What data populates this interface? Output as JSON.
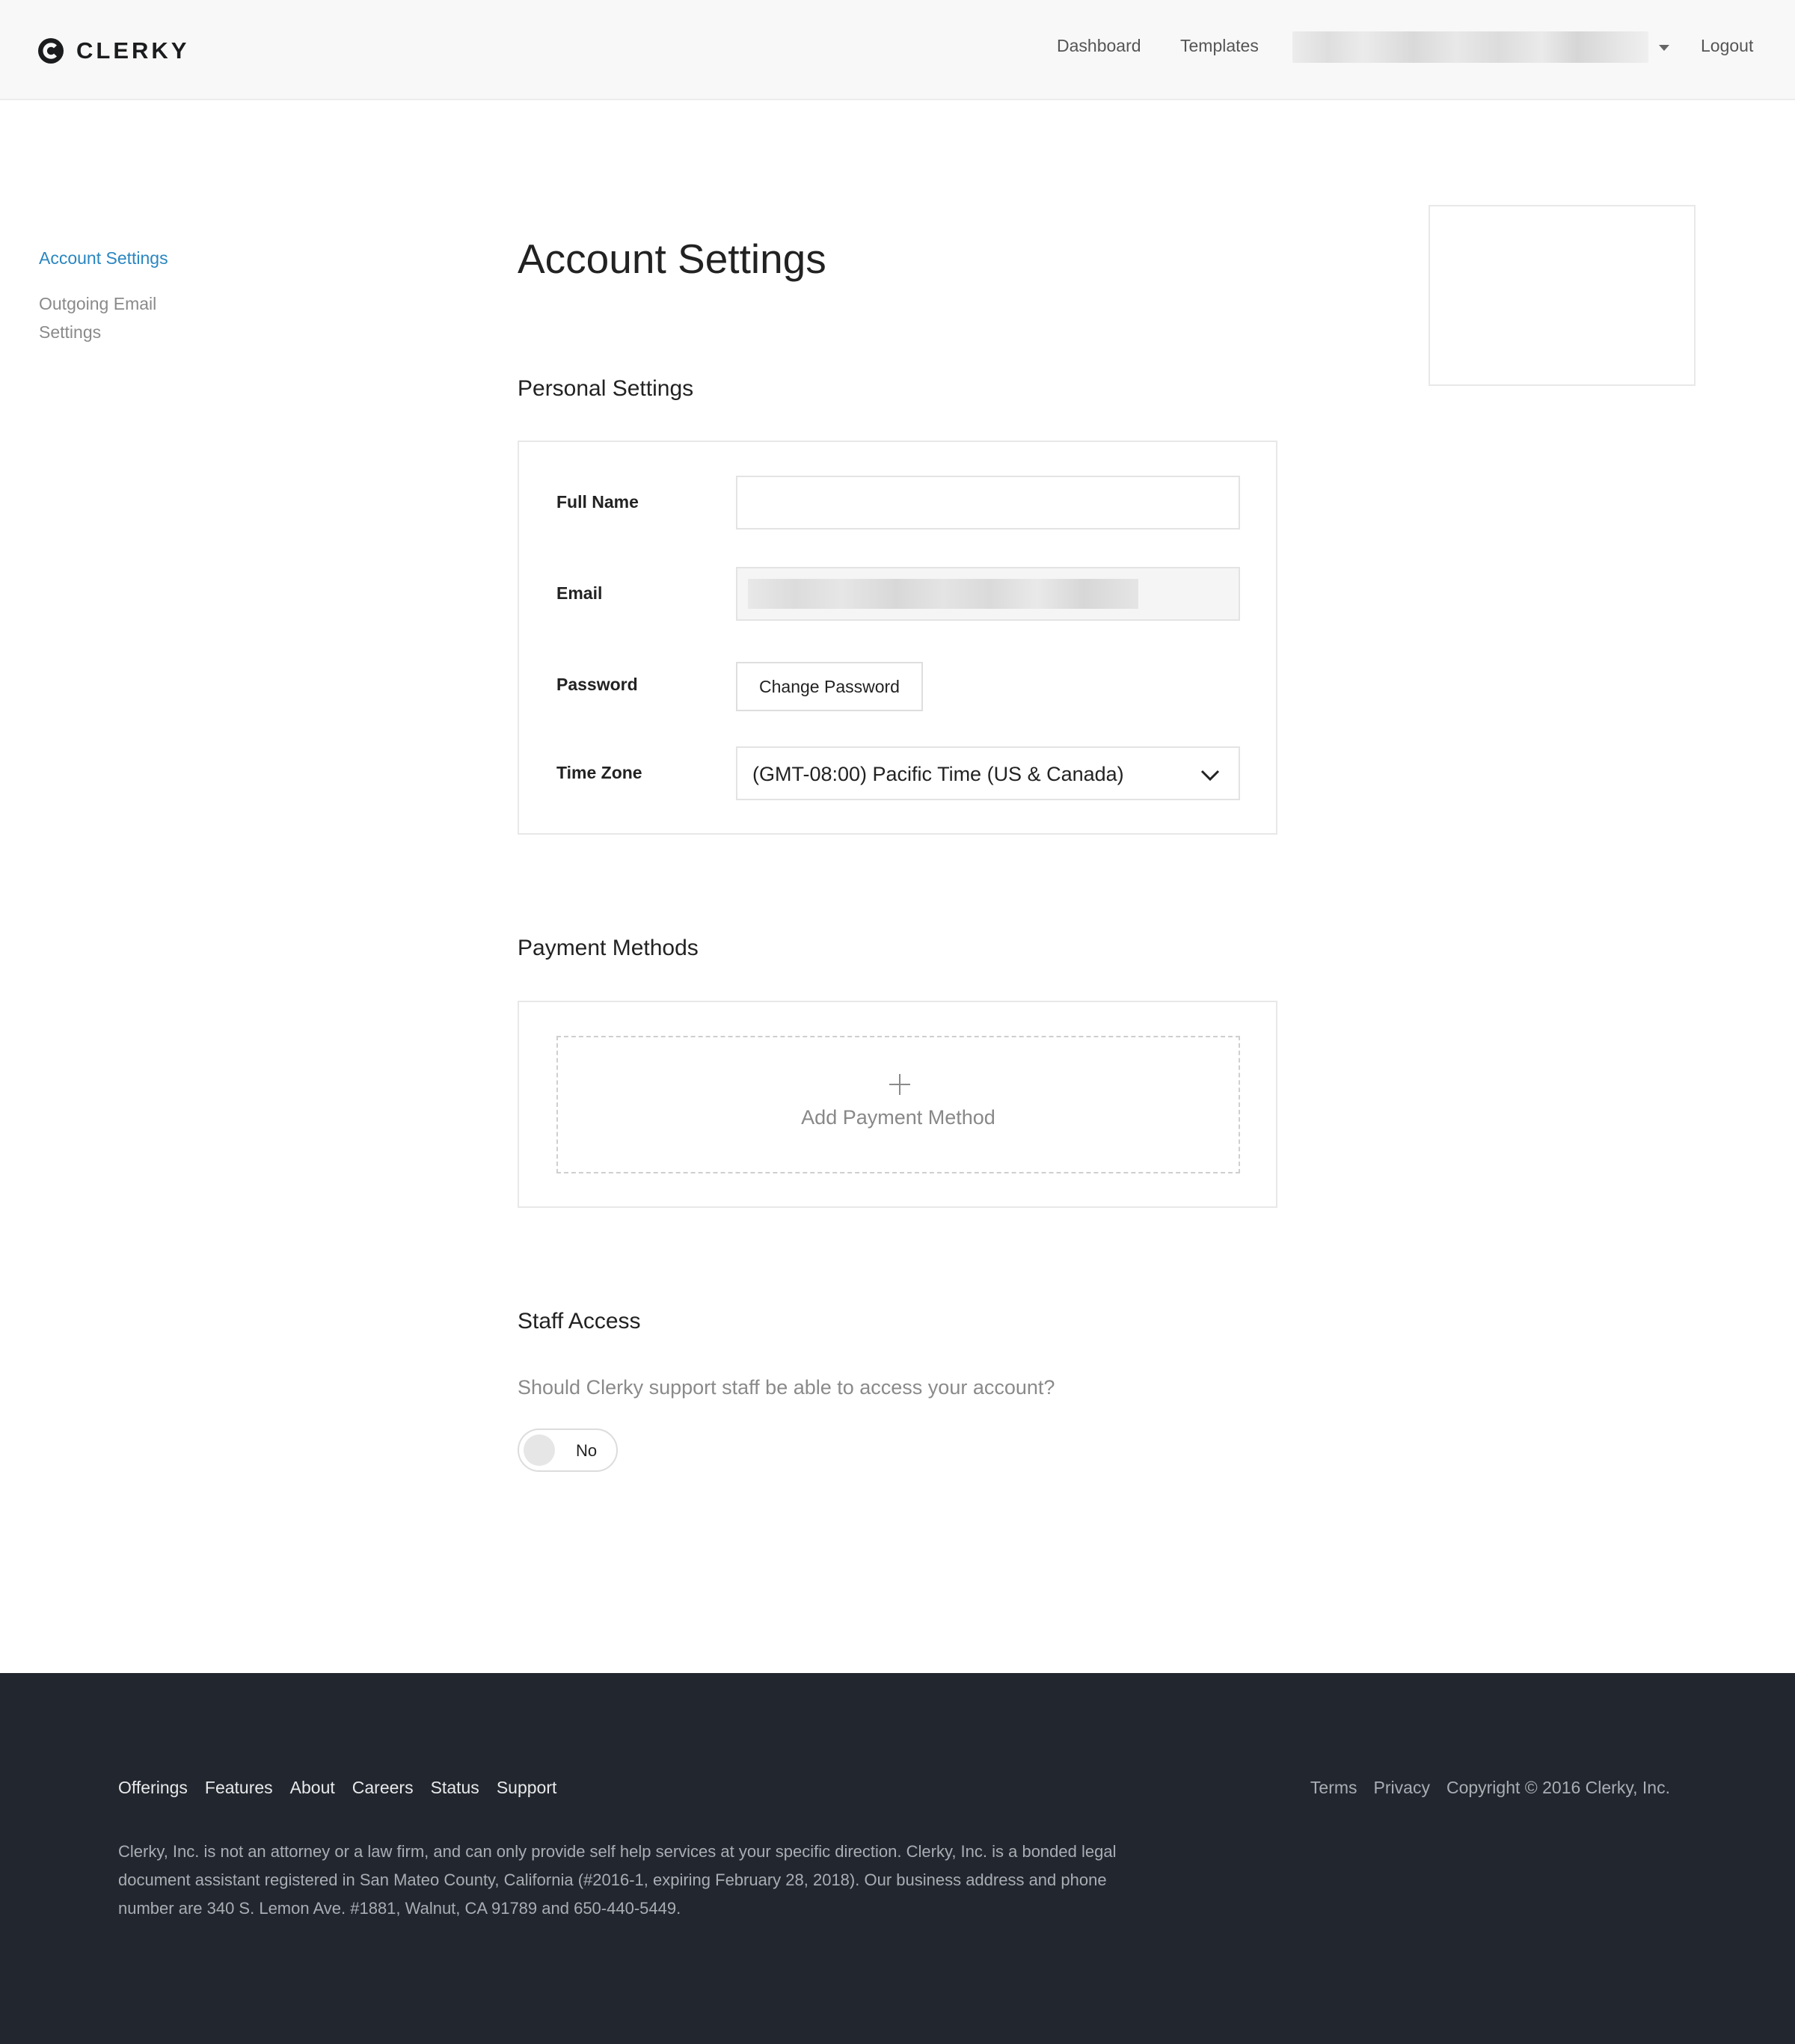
{
  "header": {
    "brand": "CLERKY",
    "nav": {
      "dashboard": "Dashboard",
      "templates": "Templates",
      "logout": "Logout"
    }
  },
  "page": {
    "title": "Account Settings"
  },
  "personal_settings": {
    "title": "Personal Settings",
    "full_name_label": "Full Name",
    "full_name_value": "",
    "email_label": "Email",
    "password_label": "Password",
    "change_password_button": "Change Password",
    "time_zone_label": "Time Zone",
    "time_zone_value": "(GMT-08:00) Pacific Time (US & Canada)"
  },
  "payment_methods": {
    "title": "Payment Methods",
    "add_label": "Add Payment Method"
  },
  "staff_access": {
    "title": "Staff Access",
    "question": "Should Clerky support staff be able to access your account?",
    "toggle_label": "No"
  },
  "sidebar": {
    "items": [
      {
        "label": "Account Settings",
        "active": true
      },
      {
        "label": "Outgoing Email Settings",
        "active": false
      }
    ]
  },
  "footer": {
    "links": [
      "Offerings",
      "Features",
      "About",
      "Careers",
      "Status",
      "Support"
    ],
    "legal_links": [
      "Terms",
      "Privacy"
    ],
    "copyright": "Copyright © 2016 Clerky, Inc.",
    "disclaimer": "Clerky, Inc. is not an attorney or a law firm, and can only provide self help services at your specific direction. Clerky, Inc. is a bonded legal document assistant registered in San Mateo County, California (#2016-1, expiring February 28, 2018). Our business address and phone number are 340 S. Lemon Ave. #1881, Walnut, CA 91789 and 650-440-5449."
  },
  "colors": {
    "accent_link": "#2a86c0",
    "footer_bg": "#22262e",
    "header_bg": "#f8f8f8"
  }
}
